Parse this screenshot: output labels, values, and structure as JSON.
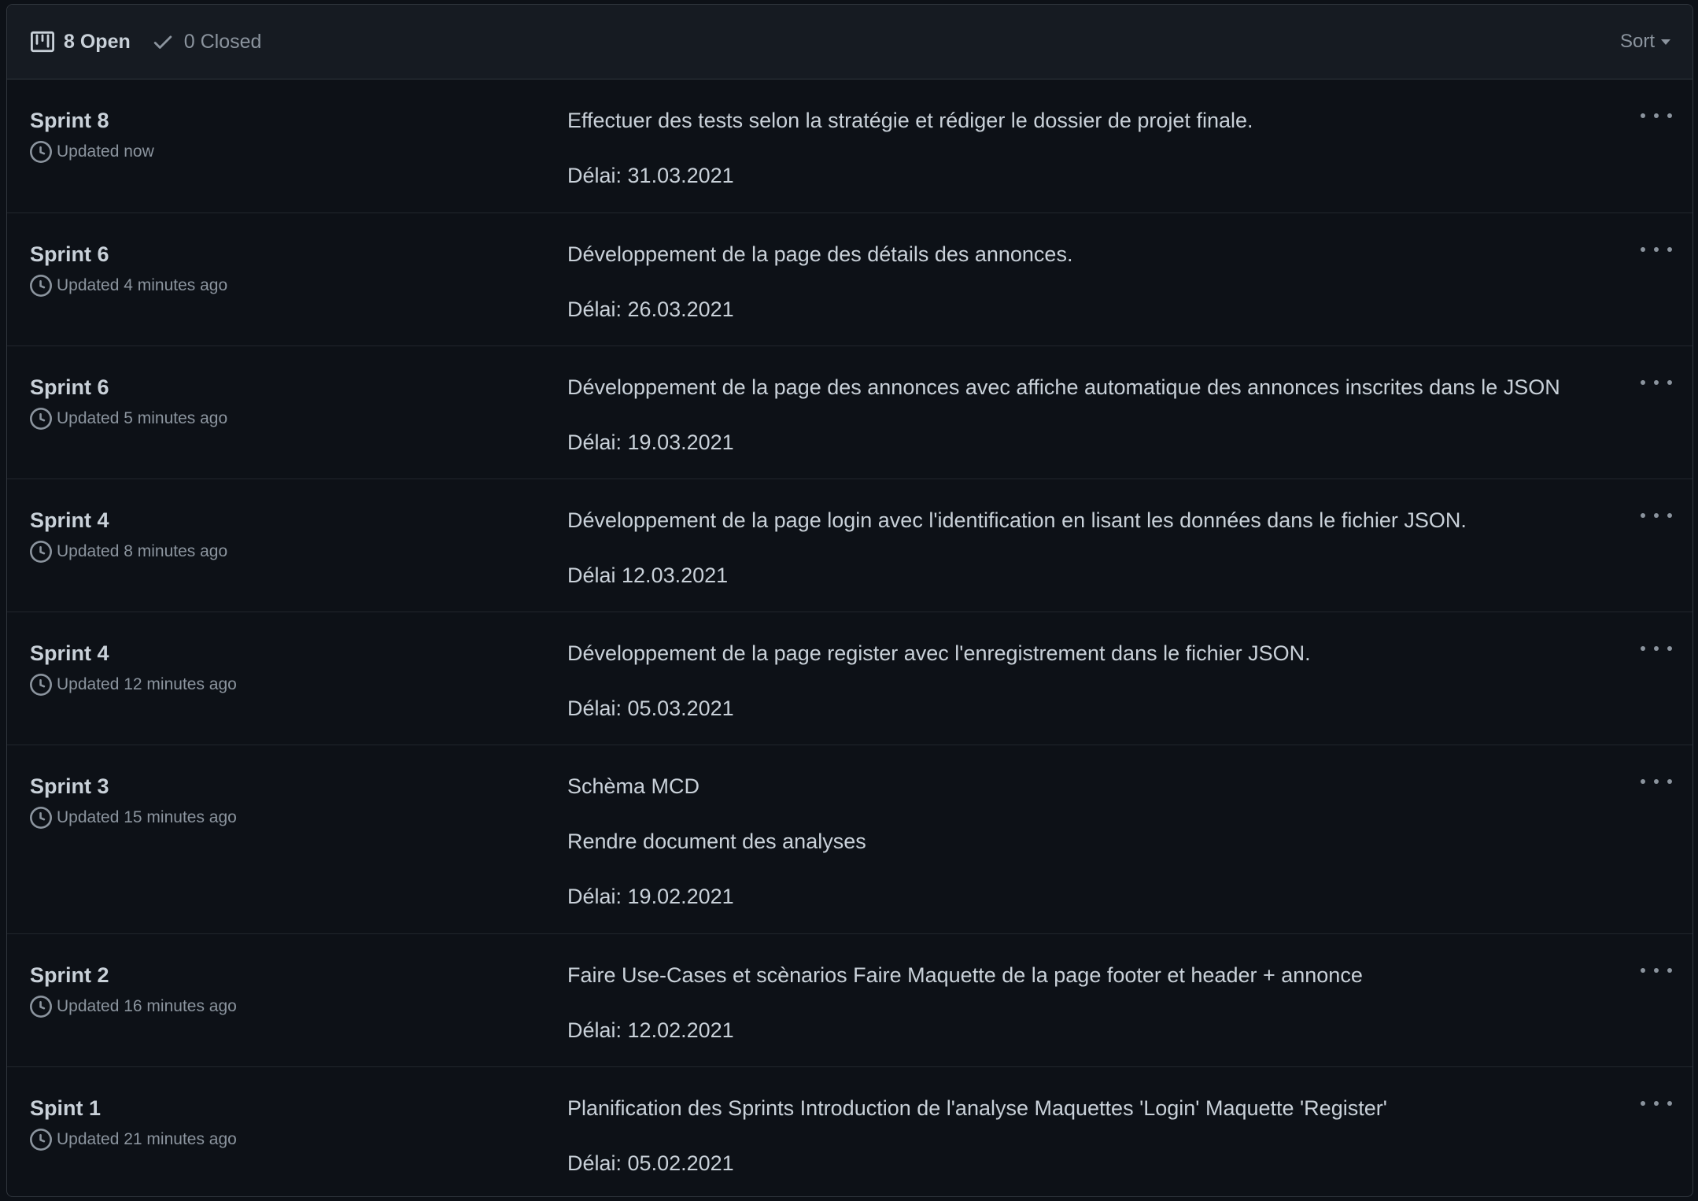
{
  "header": {
    "open_label": "8 Open",
    "closed_label": "0 Closed",
    "sort_label": "Sort"
  },
  "milestones": [
    {
      "title": "Sprint 8",
      "updated": "Updated now",
      "lines": [
        "Effectuer des tests selon la stratégie et rédiger le dossier de projet finale.",
        "Délai: 31.03.2021"
      ]
    },
    {
      "title": "Sprint 6",
      "updated": "Updated 4 minutes ago",
      "lines": [
        "Développement de la page des détails des annonces.",
        "Délai: 26.03.2021"
      ]
    },
    {
      "title": "Sprint 6",
      "updated": "Updated 5 minutes ago",
      "lines": [
        "Développement de la page des annonces avec affiche automatique des annonces inscrites dans le JSON",
        "Délai: 19.03.2021"
      ]
    },
    {
      "title": "Sprint 4",
      "updated": "Updated 8 minutes ago",
      "lines": [
        "Développement de la page login avec l'identification en lisant les données dans le fichier JSON.",
        "Délai 12.03.2021"
      ]
    },
    {
      "title": "Sprint 4",
      "updated": "Updated 12 minutes ago",
      "lines": [
        "Développement de la page register avec l'enregistrement dans le fichier JSON.",
        "Délai: 05.03.2021"
      ]
    },
    {
      "title": "Sprint 3",
      "updated": "Updated 15 minutes ago",
      "lines": [
        "Schèma MCD",
        "Rendre document des analyses",
        "Délai: 19.02.2021"
      ]
    },
    {
      "title": "Sprint 2",
      "updated": "Updated 16 minutes ago",
      "lines": [
        "Faire Use-Cases et scènarios Faire Maquette de la page footer et header + annonce",
        "Délai: 12.02.2021"
      ]
    },
    {
      "title": "Spint 1",
      "updated": "Updated 21 minutes ago",
      "lines": [
        "Planification des Sprints Introduction de l'analyse Maquettes 'Login' Maquette 'Register'",
        "Délai: 05.02.2021"
      ]
    }
  ]
}
